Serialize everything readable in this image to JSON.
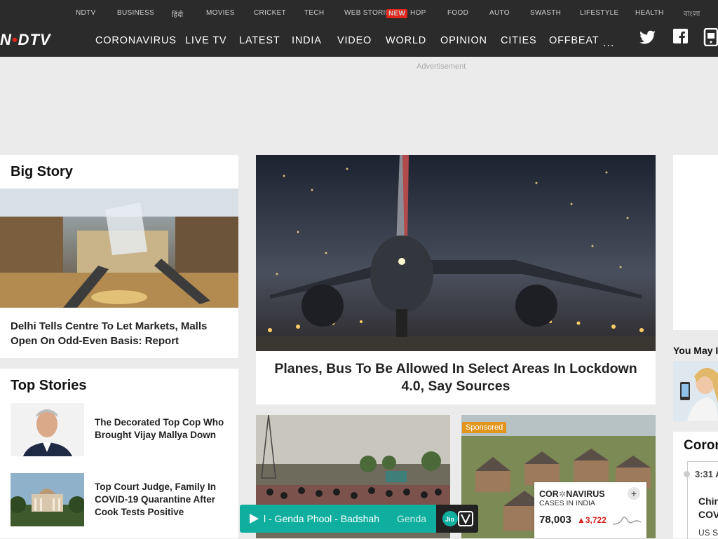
{
  "subnav": {
    "items": [
      "NDTV",
      "BUSINESS",
      "हिंदी",
      "MOVIES",
      "CRICKET",
      "TECH",
      "WEB STORIES",
      "HOP",
      "FOOD",
      "AUTO",
      "SWASTH",
      "LIFESTYLE",
      "HEALTH",
      "বাংলা"
    ],
    "new_badge": "NEW"
  },
  "logo": {
    "text_a": "N",
    "text_dot": "•",
    "text_b": "DTV"
  },
  "mainnav": {
    "items": [
      "CORONAVIRUS",
      "LIVE TV",
      "LATEST",
      "INDIA",
      "VIDEO",
      "WORLD",
      "OPINION",
      "CITIES",
      "OFFBEAT"
    ],
    "more": "..."
  },
  "social_icons": [
    "twitter-icon",
    "facebook-icon",
    "app-icon"
  ],
  "ad": {
    "label": "Advertisement"
  },
  "big_story": {
    "heading": "Big Story",
    "headline": "Delhi Tells Centre To Let Markets, Malls Open On Odd-Even Basis: Report"
  },
  "lead": {
    "headline": "Planes, Bus To Be Allowed In Select Areas In Lockdown 4.0, Say Sources"
  },
  "top_stories": {
    "heading": "Top Stories",
    "items": [
      {
        "headline": "The Decorated Top Cop Who Brought Vijay Mallya Down"
      },
      {
        "headline": "Top Court Judge, Family In COVID-19 Quarantine After Cook Tests Positive"
      }
    ]
  },
  "sponsored": {
    "label": "Sponsored"
  },
  "covid_widget": {
    "title_a": "COR",
    "title_b": "NAVIRUS",
    "subtitle": "CASES IN INDIA",
    "cases": "78,003",
    "delta": "▲3,722",
    "expand": "+"
  },
  "player": {
    "track_text": "l - Genda Phool - Badshah",
    "track_text_next": "Genda"
  },
  "right_col": {
    "you_may": "You May I",
    "corona_heading": "Coron",
    "live_time": "3:31 A",
    "live_headline_a": "Chin",
    "live_headline_b": "COV",
    "live_sub": "US S"
  },
  "colors": {
    "topbar": "#2b2b2b",
    "accent_red": "#e1251b",
    "page_bg": "#ebebeb",
    "player": "#0fae9f"
  }
}
